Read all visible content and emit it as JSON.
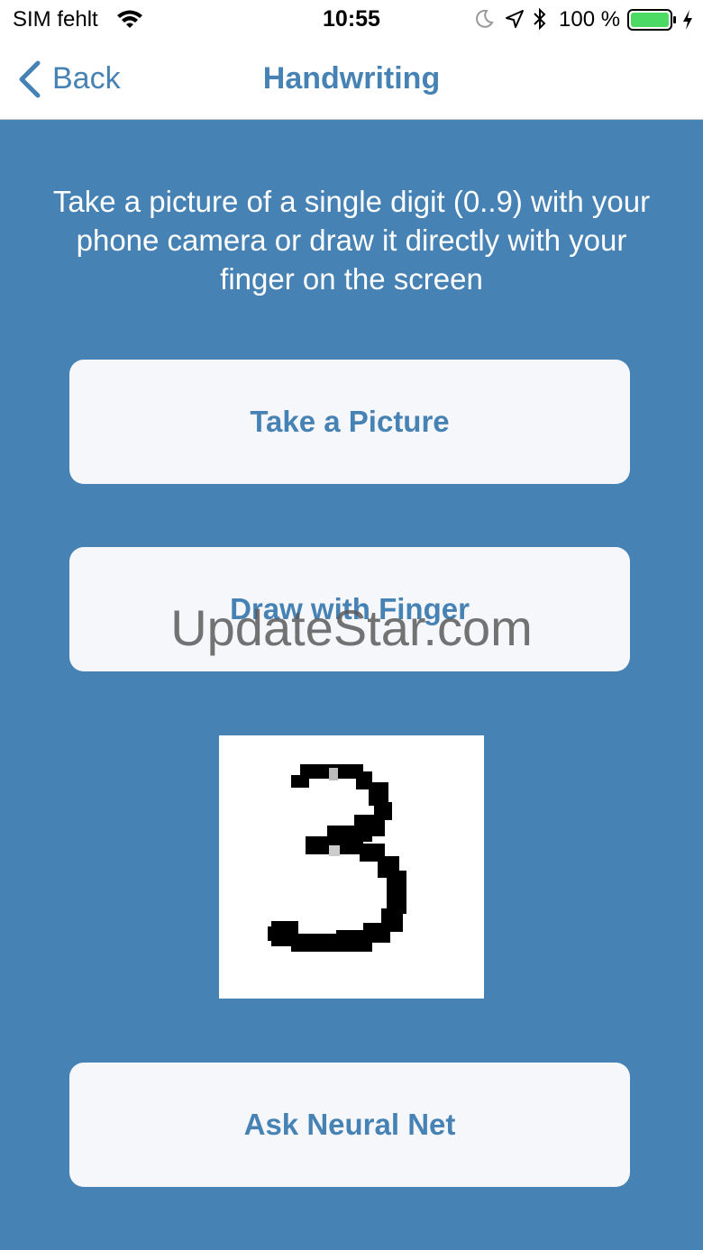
{
  "status_bar": {
    "carrier": "SIM fehlt",
    "time": "10:55",
    "battery_percent": "100 %",
    "icons": [
      "wifi-icon",
      "moon-icon",
      "location-arrow-icon",
      "bluetooth-icon",
      "battery-icon",
      "charging-bolt-icon"
    ],
    "battery_color": "#4cd964"
  },
  "nav": {
    "back_label": "Back",
    "title": "Handwriting"
  },
  "main": {
    "instructions": "Take a picture of a single digit (0..9) with your phone camera or draw it directly with your finger on the screen",
    "take_picture_label": "Take a Picture",
    "draw_label": "Draw with Finger",
    "ask_label": "Ask Neural Net",
    "digit_image": "handwritten digit 3"
  },
  "watermark": "UpdateStar.com",
  "colors": {
    "accent": "#4682b4",
    "background": "#4682b4",
    "button_bg": "#f5f7fb"
  }
}
